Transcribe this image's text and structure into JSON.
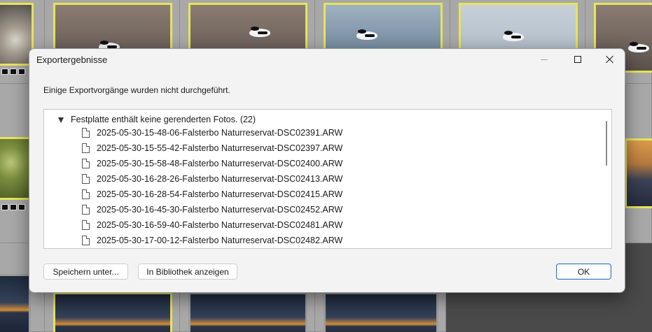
{
  "dialog": {
    "title": "Exportergebnisse",
    "message": "Einige Exportvorgänge wurden nicht durchgeführt.",
    "group": {
      "label": "Festplatte enthält keine gerenderten Fotos. (22)",
      "files": [
        "2025-05-30-15-48-06-Falsterbo Naturreservat-DSC02391.ARW",
        "2025-05-30-15-55-42-Falsterbo Naturreservat-DSC02397.ARW",
        "2025-05-30-15-58-48-Falsterbo Naturreservat-DSC02400.ARW",
        "2025-05-30-16-28-26-Falsterbo Naturreservat-DSC02413.ARW",
        "2025-05-30-16-28-54-Falsterbo Naturreservat-DSC02415.ARW",
        "2025-05-30-16-45-30-Falsterbo Naturreservat-DSC02452.ARW",
        "2025-05-30-16-59-40-Falsterbo Naturreservat-DSC02481.ARW",
        "2025-05-30-17-00-12-Falsterbo Naturreservat-DSC02482.ARW"
      ]
    },
    "buttons": {
      "save_as": "Speichern unter...",
      "show_in_library": "In Bibliothek anzeigen",
      "ok": "OK"
    }
  },
  "colors": {
    "selection_border": "#e6e45a",
    "ok_border": "#2f6fbf",
    "dialog_bg": "#f3f3f3"
  }
}
